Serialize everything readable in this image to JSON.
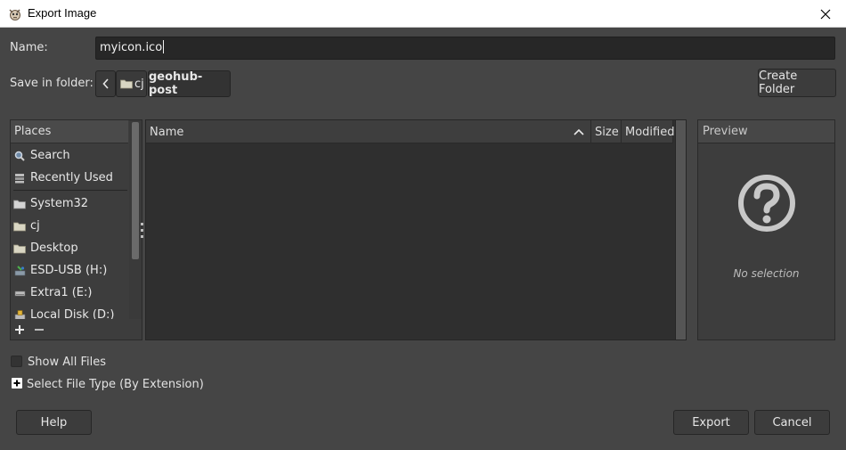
{
  "window": {
    "title": "Export Image",
    "app_icon": "gimp-icon",
    "close_icon": "close-icon"
  },
  "name": {
    "label": "Name:",
    "value": "myicon.ico"
  },
  "folder": {
    "label": "Save in folder:",
    "back_icon": "chevron-left-icon",
    "crumbs": [
      "cj",
      "geohub-post"
    ],
    "create_folder_label": "Create Folder"
  },
  "places": {
    "header": "Places",
    "items": [
      {
        "label": "Search",
        "icon": "search-icon"
      },
      {
        "label": "Recently Used",
        "icon": "recent-icon"
      },
      {
        "label": "System32",
        "icon": "folder-icon"
      },
      {
        "label": "cj",
        "icon": "folder-icon"
      },
      {
        "label": "Desktop",
        "icon": "folder-icon"
      },
      {
        "label": "ESD-USB (H:)",
        "icon": "usb-drive-icon"
      },
      {
        "label": "Extra1 (E:)",
        "icon": "drive-icon"
      },
      {
        "label": "Local Disk (D:)",
        "icon": "locked-drive-icon"
      }
    ],
    "add_icon": "plus-icon",
    "remove_icon": "minus-icon"
  },
  "filelist": {
    "columns": [
      "Name",
      "Size",
      "Modified"
    ],
    "sort_icon": "chevron-up-icon",
    "rows": []
  },
  "preview": {
    "header": "Preview",
    "icon": "question-circle-icon",
    "empty_text": "No selection"
  },
  "options": {
    "show_all_files": "Show All Files",
    "file_type": "Select File Type (By Extension)",
    "expander_icon": "plus-expander-icon"
  },
  "buttons": {
    "help": "Help",
    "export": "Export",
    "cancel": "Cancel"
  }
}
